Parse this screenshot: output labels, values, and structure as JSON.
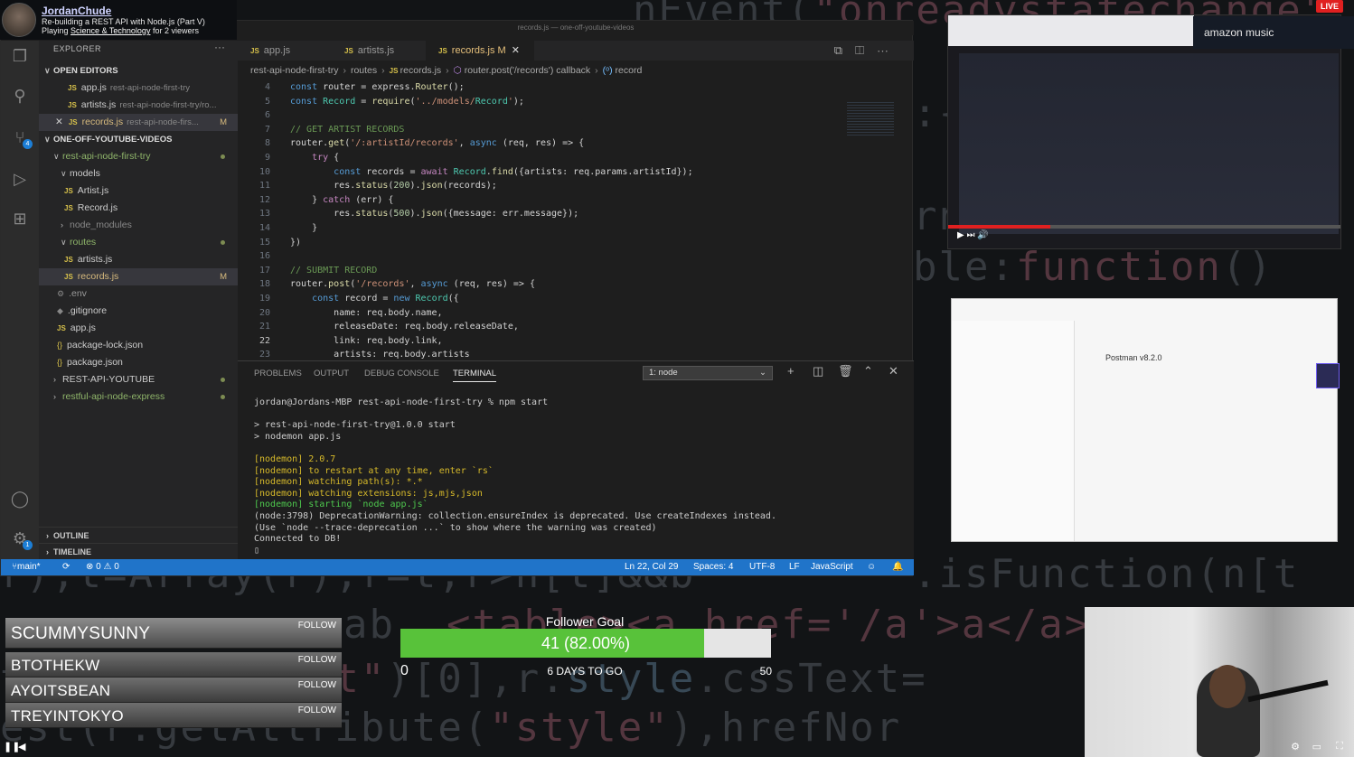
{
  "streamer": {
    "name": "JordanChude",
    "title": "Re-building a REST API with Node.js (Part V)",
    "playing_prefix": "Playing",
    "category": "Science & Technology",
    "viewers": "for 2 viewers"
  },
  "live_badge": "LIVE",
  "amazon_music": "amazon music",
  "vscode": {
    "window_title": "records.js — one-off-youtube-videos",
    "explorer": {
      "title": "EXPLORER",
      "more": "···",
      "open_editors": "OPEN EDITORS",
      "open_files": [
        {
          "name": "app.js",
          "path": "rest-api-node-first-try"
        },
        {
          "name": "artists.js",
          "path": "rest-api-node-first-try/ro..."
        },
        {
          "name": "records.js",
          "path": "rest-api-node-firs...",
          "status": "M"
        }
      ],
      "workspace": "ONE-OFF-YOUTUBE-VIDEOS",
      "tree": {
        "project": "rest-api-node-first-try",
        "models": "models",
        "artist_model": "Artist.js",
        "record_model": "Record.js",
        "node_modules": "node_modules",
        "routes": "routes",
        "artists_route": "artists.js",
        "records_route": "records.js",
        "records_status": "M",
        "env": ".env",
        "gitignore": ".gitignore",
        "app": "app.js",
        "package_lock": "package-lock.json",
        "package": "package.json",
        "rest_api_youtube": "REST-API-YOUTUBE",
        "restful": "restful-api-node-express"
      },
      "outline": "OUTLINE",
      "timeline": "TIMELINE"
    },
    "tabs": [
      {
        "label": "app.js"
      },
      {
        "label": "artists.js"
      },
      {
        "label": "records.js",
        "suffix": "M",
        "close": "✕"
      }
    ],
    "breadcrumb": {
      "folder1": "rest-api-node-first-try",
      "folder2": "routes",
      "file": "records.js",
      "callback": "router.post('/records') callback",
      "symbol": "record"
    },
    "code": [
      {
        "n": "4",
        "t": "const router = express.Router();"
      },
      {
        "n": "5",
        "t": "const Record = require('../models/Record');"
      },
      {
        "n": "6",
        "t": ""
      },
      {
        "n": "7",
        "t": "// GET ARTIST RECORDS"
      },
      {
        "n": "8",
        "t": "router.get('/:artistId/records', async (req, res) => {"
      },
      {
        "n": "9",
        "t": "    try {"
      },
      {
        "n": "10",
        "t": "        const records = await Record.find({artists: req.params.artistId});"
      },
      {
        "n": "11",
        "t": "        res.status(200).json(records);"
      },
      {
        "n": "12",
        "t": "    } catch (err) {"
      },
      {
        "n": "13",
        "t": "        res.status(500).json({message: err.message});"
      },
      {
        "n": "14",
        "t": "    }"
      },
      {
        "n": "15",
        "t": "})"
      },
      {
        "n": "16",
        "t": ""
      },
      {
        "n": "17",
        "t": "// SUBMIT RECORD"
      },
      {
        "n": "18",
        "t": "router.post('/records', async (req, res) => {"
      },
      {
        "n": "19",
        "t": "    const record = new Record({"
      },
      {
        "n": "20",
        "t": "        name: req.body.name,"
      },
      {
        "n": "21",
        "t": "        releaseDate: req.body.releaseDate,"
      },
      {
        "n": "22",
        "t": "        link: req.body.link,"
      },
      {
        "n": "23",
        "t": "        artists: req.body.artists"
      }
    ],
    "panel": {
      "tabs": [
        "PROBLEMS",
        "OUTPUT",
        "DEBUG CONSOLE",
        "TERMINAL"
      ],
      "terminal_select": "1: node",
      "terminal_lines": [
        {
          "t": "jordan@Jordans-MBP rest-api-node-first-try % npm start",
          "c": ""
        },
        {
          "t": "",
          "c": ""
        },
        {
          "t": "> rest-api-node-first-try@1.0.0 start",
          "c": ""
        },
        {
          "t": "> nodemon app.js",
          "c": ""
        },
        {
          "t": "",
          "c": ""
        },
        {
          "t": "[nodemon] 2.0.7",
          "c": "y"
        },
        {
          "t": "[nodemon] to restart at any time, enter `rs`",
          "c": "y"
        },
        {
          "t": "[nodemon] watching path(s): *.*",
          "c": "y"
        },
        {
          "t": "[nodemon] watching extensions: js,mjs,json",
          "c": "y"
        },
        {
          "t": "[nodemon] starting `node app.js`",
          "c": "g"
        },
        {
          "t": "(node:3798) DeprecationWarning: collection.ensureIndex is deprecated. Use createIndexes instead.",
          "c": ""
        },
        {
          "t": "(Use `node --trace-deprecation ...` to show where the warning was created)",
          "c": ""
        },
        {
          "t": "Connected to DB!",
          "c": ""
        },
        {
          "t": "▯",
          "c": ""
        }
      ]
    },
    "statusbar": {
      "branch": "main*",
      "problems": "⊗ 0 ⚠ 0",
      "position": "Ln 22, Col 29",
      "spaces": "Spaces: 4",
      "encoding": "UTF-8",
      "eol": "LF",
      "language": "JavaScript"
    }
  },
  "postman": {
    "version_title": "Postman v8.2.0"
  },
  "followers": [
    {
      "name": "SCUMMYSUNNY",
      "button": "FOLLOW"
    },
    {
      "name": "BTOTHEKW",
      "button": "FOLLOW"
    },
    {
      "name": "AYOITSBEAN",
      "button": "FOLLOW"
    },
    {
      "name": "TREYINTOKYO",
      "button": "FOLLOW"
    }
  ],
  "follower_goal": {
    "title": "Follower Goal",
    "label": "41 (82.00%)",
    "current": 41,
    "target": 50,
    "progress": 0.82,
    "min_label": "0",
    "max_label": "50",
    "days_left": "6 DAYS TO GO"
  },
  "colors": {
    "vscode_bg": "#1e1e1e",
    "status_bar": "#2074c9",
    "goal_fill": "#58c23a",
    "live": "#e02020"
  }
}
